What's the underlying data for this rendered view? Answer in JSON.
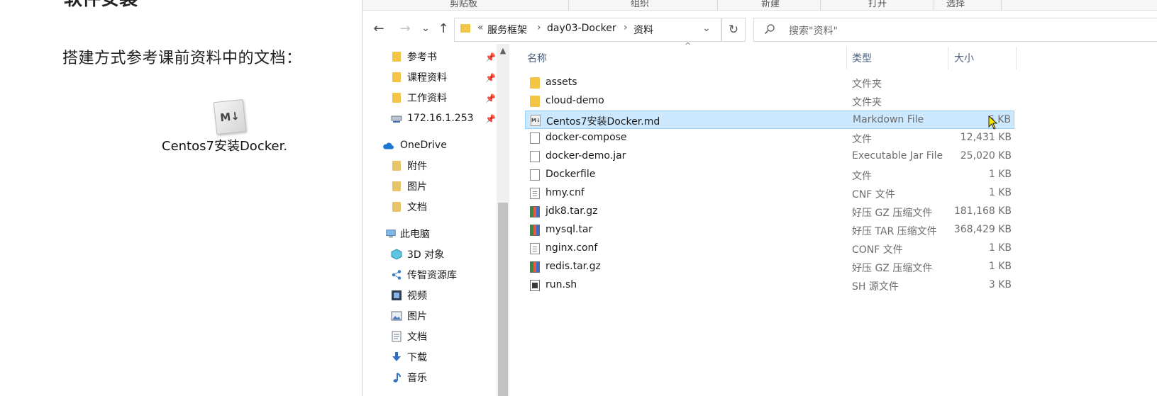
{
  "doc": {
    "heading_fragment": "软件安装",
    "instruction": "搭建方式参考课前资料中的文档：",
    "attachment_icon_text": "M↓",
    "attachment_caption": "Centos7安装Docker."
  },
  "ribbon": {
    "groups": [
      "剪贴板",
      "组织",
      "新建",
      "打开",
      "选择"
    ]
  },
  "toolbar": {
    "back_icon": "←",
    "forward_icon": "→",
    "recent_icon": "⌄",
    "up_icon": "↑",
    "refresh_icon": "↻"
  },
  "address": {
    "overflow": "«",
    "segments": [
      "服务框架",
      "day03-Docker",
      "资料"
    ],
    "separator": "›",
    "dropdown": "⌄"
  },
  "search": {
    "placeholder": "搜索\"资料\""
  },
  "nav": {
    "quick_access": [
      {
        "label": "参考书",
        "icon": "folder-icon",
        "pinned": true
      },
      {
        "label": "课程资料",
        "icon": "folder-icon",
        "pinned": true
      },
      {
        "label": "工作资料",
        "icon": "folder-icon",
        "pinned": true
      },
      {
        "label": "172.16.1.253",
        "icon": "network-drive-icon",
        "pinned": true
      }
    ],
    "onedrive": {
      "label": "OneDrive",
      "items": [
        "附件",
        "图片",
        "文档"
      ]
    },
    "this_pc": {
      "label": "此电脑",
      "items": [
        {
          "label": "3D 对象",
          "icon": "3d-objects-icon"
        },
        {
          "label": "传智资源库",
          "icon": "network-share-icon"
        },
        {
          "label": "视频",
          "icon": "video-icon"
        },
        {
          "label": "图片",
          "icon": "pictures-icon"
        },
        {
          "label": "文档",
          "icon": "documents-icon"
        },
        {
          "label": "下载",
          "icon": "download-icon"
        },
        {
          "label": "音乐",
          "icon": "music-icon"
        }
      ]
    }
  },
  "columns": {
    "name": "名称",
    "type": "类型",
    "size": "大小"
  },
  "files": [
    {
      "name": "assets",
      "type": "文件夹",
      "size": "",
      "icon": "folder-icon"
    },
    {
      "name": "cloud-demo",
      "type": "文件夹",
      "size": "",
      "icon": "folder-icon"
    },
    {
      "name": "Centos7安装Docker.md",
      "type": "Markdown File",
      "size": "6 KB",
      "icon": "markdown-file-icon",
      "selected": true
    },
    {
      "name": "docker-compose",
      "type": "文件",
      "size": "12,431 KB",
      "icon": "file-icon"
    },
    {
      "name": "docker-demo.jar",
      "type": "Executable Jar File",
      "size": "25,020 KB",
      "icon": "file-icon"
    },
    {
      "name": "Dockerfile",
      "type": "文件",
      "size": "1 KB",
      "icon": "file-icon"
    },
    {
      "name": "hmy.cnf",
      "type": "CNF 文件",
      "size": "1 KB",
      "icon": "text-file-icon"
    },
    {
      "name": "jdk8.tar.gz",
      "type": "好压 GZ 压缩文件",
      "size": "181,168 KB",
      "icon": "archive-icon"
    },
    {
      "name": "mysql.tar",
      "type": "好压 TAR 压缩文件",
      "size": "368,429 KB",
      "icon": "archive-icon"
    },
    {
      "name": "nginx.conf",
      "type": "CONF 文件",
      "size": "1 KB",
      "icon": "text-file-icon"
    },
    {
      "name": "redis.tar.gz",
      "type": "好压 GZ 压缩文件",
      "size": "1 KB",
      "icon": "archive-icon"
    },
    {
      "name": "run.sh",
      "type": "SH 源文件",
      "size": "3 KB",
      "icon": "script-file-icon"
    }
  ]
}
